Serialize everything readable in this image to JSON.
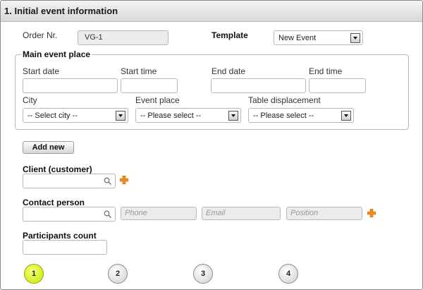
{
  "section": {
    "title": "1. Initial event information"
  },
  "order": {
    "label": "Order Nr.",
    "value": "VG-1"
  },
  "template": {
    "label": "Template",
    "value": "New Event"
  },
  "main_event_place": {
    "legend": "Main event place",
    "start_date_label": "Start date",
    "start_time_label": "Start time",
    "end_date_label": "End date",
    "end_time_label": "End time",
    "city_label": "City",
    "city_value": "-- Select city --",
    "event_place_label": "Event place",
    "event_place_value": "-- Please select --",
    "table_label": "Table displacement",
    "table_value": "-- Please select --"
  },
  "add_new_label": "Add new",
  "client": {
    "label": "Client (customer)"
  },
  "contact": {
    "label": "Contact person",
    "phone_placeholder": "Phone",
    "email_placeholder": "Email",
    "position_placeholder": "Position"
  },
  "participants": {
    "label": "Participants count"
  },
  "steps": [
    "1",
    "2",
    "3",
    "4"
  ],
  "colors": {
    "active_step": "#c6e600",
    "plus_icon": "#f08c1e"
  }
}
